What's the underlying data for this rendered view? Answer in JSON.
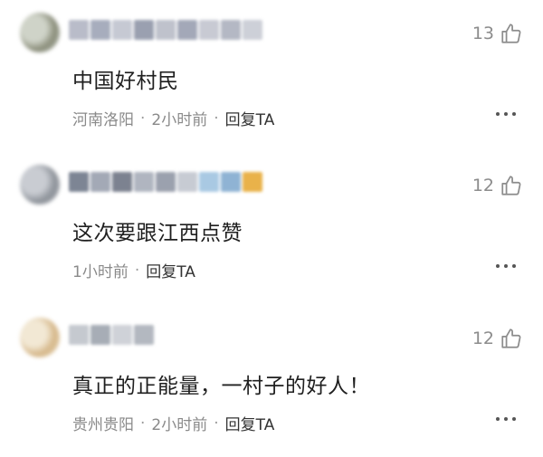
{
  "comments": [
    {
      "text": "中国好村民",
      "location": "河南洛阳",
      "time": "2小时前",
      "reply": "回复TA",
      "likes": "13",
      "avatar_colors": [
        "#b9c0b8",
        "#8c8f7c",
        "#cfd3c8"
      ],
      "name_colors": [
        "#b9bcc9",
        "#a7adbd",
        "#c6c9d3",
        "#9aa0b0",
        "#bfc2cc",
        "#a3a8b8",
        "#c8cad3",
        "#b4b8c4",
        "#cdd0d8"
      ]
    },
    {
      "text": "这次要跟江西点赞",
      "location": "",
      "time": "1小时前",
      "reply": "回复TA",
      "likes": "12",
      "avatar_colors": [
        "#a9acb2",
        "#8f949b",
        "#c9ccd2"
      ],
      "name_colors": [
        "#7d8594",
        "#a3a9b6",
        "#7c8290",
        "#b0b5c0",
        "#9ba1ae",
        "#c7cbd3",
        "#a9c9e3",
        "#8fb3d4",
        "#e9b24a"
      ]
    },
    {
      "text": "真正的正能量，一村子的好人！",
      "location": "贵州贵阳",
      "time": "2小时前",
      "reply": "回复TA",
      "likes": "12",
      "avatar_colors": [
        "#e9dcc0",
        "#d6b88b",
        "#f2e8d4"
      ],
      "name_colors": [
        "#c5c9cf",
        "#a7adb6",
        "#cfd2d8",
        "#b3b8c0"
      ]
    }
  ]
}
